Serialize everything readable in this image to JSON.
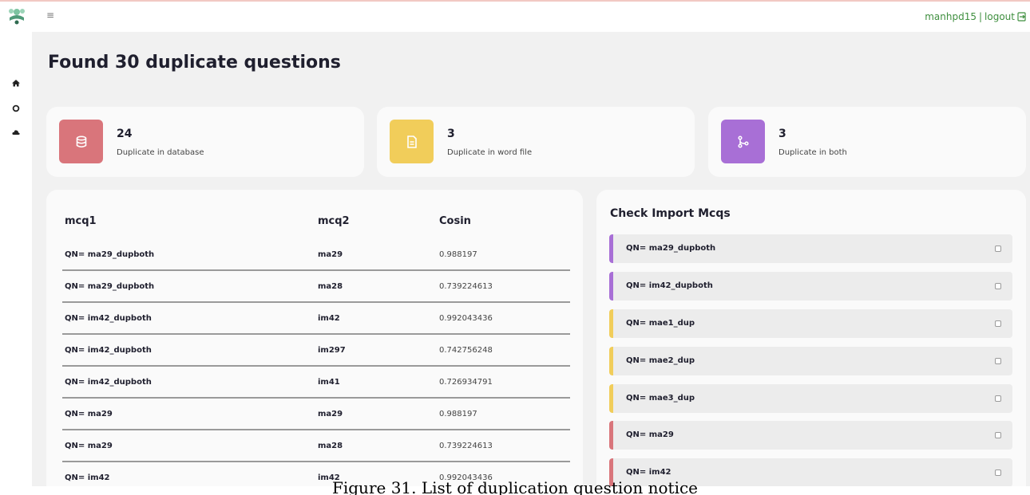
{
  "header": {
    "menu_glyph": "≡",
    "username": "manhpd15",
    "separator": "|",
    "logout_label": "logout"
  },
  "page": {
    "title_prefix": "Found",
    "title_count": "30",
    "title_suffix": "duplicate questions"
  },
  "stats": [
    {
      "value": "24",
      "label": "Duplicate in database",
      "color": "#d9757b",
      "icon": "database-icon"
    },
    {
      "value": "3",
      "label": "Duplicate in word file",
      "color": "#f1cd5a",
      "icon": "document-icon"
    },
    {
      "value": "3",
      "label": "Duplicate in both",
      "color": "#a86fd6",
      "icon": "branch-icon"
    }
  ],
  "table": {
    "headers": [
      "mcq1",
      "mcq2",
      "Cosin"
    ],
    "rows": [
      [
        "QN= ma29_dupboth",
        "ma29",
        "0.988197"
      ],
      [
        "QN= ma29_dupboth",
        "ma28",
        "0.739224613"
      ],
      [
        "QN= im42_dupboth",
        "im42",
        "0.992043436"
      ],
      [
        "QN= im42_dupboth",
        "im297",
        "0.742756248"
      ],
      [
        "QN= im42_dupboth",
        "im41",
        "0.726934791"
      ],
      [
        "QN= ma29",
        "ma29",
        "0.988197"
      ],
      [
        "QN= ma29",
        "ma28",
        "0.739224613"
      ],
      [
        "QN= im42",
        "im42",
        "0.992043436"
      ]
    ]
  },
  "check": {
    "title": "Check Import Mcqs",
    "items": [
      {
        "label": "QN= ma29_dupboth",
        "color": "#a86fd6"
      },
      {
        "label": "QN= im42_dupboth",
        "color": "#a86fd6"
      },
      {
        "label": "QN= mae1_dup",
        "color": "#f1cd5a"
      },
      {
        "label": "QN= mae2_dup",
        "color": "#f1cd5a"
      },
      {
        "label": "QN= mae3_dup",
        "color": "#f1cd5a"
      },
      {
        "label": "QN= ma29",
        "color": "#d9757b"
      },
      {
        "label": "QN= im42",
        "color": "#d9757b"
      }
    ]
  },
  "caption": "Figure 31. List of duplication question notice",
  "colors": {
    "accent_green": "#3f8f3f"
  }
}
